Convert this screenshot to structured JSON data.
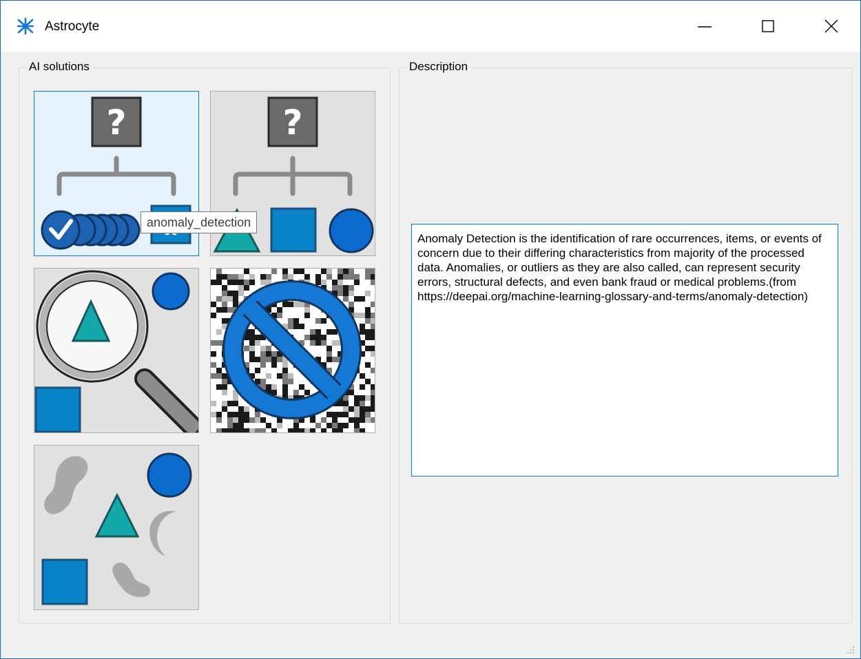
{
  "window": {
    "title": "Astrocyte",
    "app_icon": "astrocyte-logo-icon",
    "controls": [
      "minimize-icon",
      "maximize-icon",
      "close-icon"
    ]
  },
  "solutions": {
    "group_label": "AI solutions",
    "tiles": [
      {
        "id": "anomaly_detection",
        "icon": "anomaly-detection-icon",
        "selected": true
      },
      {
        "id": "classification",
        "icon": "classification-icon",
        "selected": false
      },
      {
        "id": "object_detection",
        "icon": "magnifier-search-icon",
        "selected": false
      },
      {
        "id": "denoising",
        "icon": "no-noise-icon",
        "selected": false
      },
      {
        "id": "clustering",
        "icon": "shapes-clustering-icon",
        "selected": false
      }
    ],
    "tooltip": "anomaly_detection"
  },
  "description": {
    "group_label": "Description",
    "text": "Anomaly Detection is the identification of rare occurrences, items, or events of concern due to their differing characteristics from majority of the processed data. Anomalies, or outliers as they are also called, can represent security errors, structural defects, and even bank fraud or medical problems.(from https://deepai.org/machine-learning-glossary-and-terms/anomaly-detection)"
  },
  "colors": {
    "accent": "#0078d7",
    "shape_blue": "#0a84c8",
    "circle_blue": "#0b6bcf",
    "triangle_teal": "#14a8ab",
    "dark_gray": "#6b6b6b",
    "window_border": "#1b6ab3"
  }
}
